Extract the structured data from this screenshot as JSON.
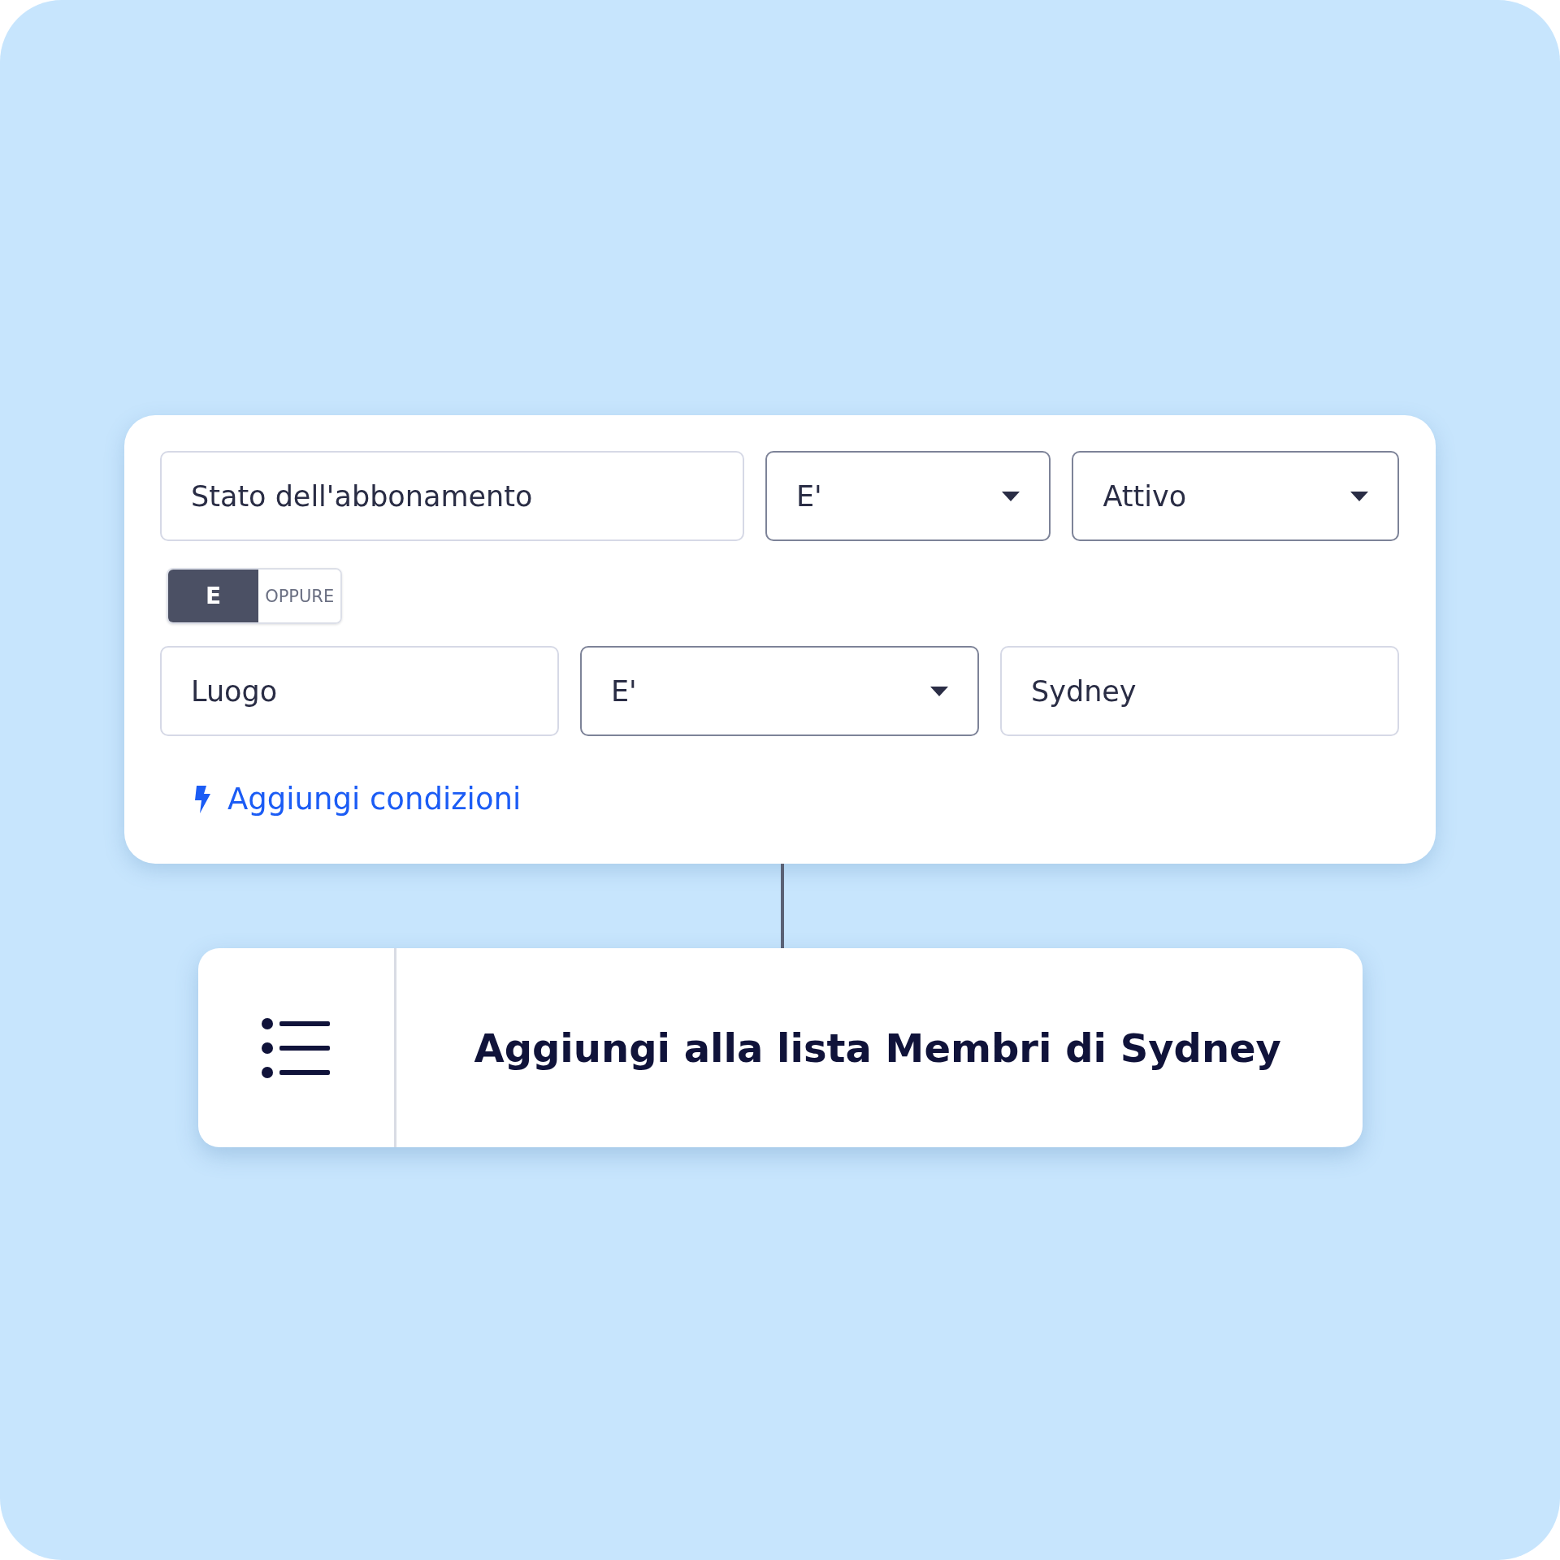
{
  "filter_card": {
    "condition_rows": [
      {
        "fields": [
          {
            "kind": "text",
            "value": "Stato dell'abbonamento"
          },
          {
            "kind": "dropdown",
            "value": "E'"
          },
          {
            "kind": "dropdown",
            "value": "Attivo"
          }
        ]
      },
      {
        "fields": [
          {
            "kind": "text",
            "value": "Luogo"
          },
          {
            "kind": "dropdown",
            "value": "E'"
          },
          {
            "kind": "text",
            "value": "Sydney"
          }
        ]
      }
    ],
    "logic_toggle": {
      "options": [
        {
          "label": "E",
          "selected": true
        },
        {
          "label": "OPPURE",
          "selected": false
        }
      ]
    },
    "add_conditions_link": {
      "label": "Aggiungi condizioni"
    }
  },
  "action_card": {
    "label": "Aggiungi alla lista Membri di Sydney"
  }
}
